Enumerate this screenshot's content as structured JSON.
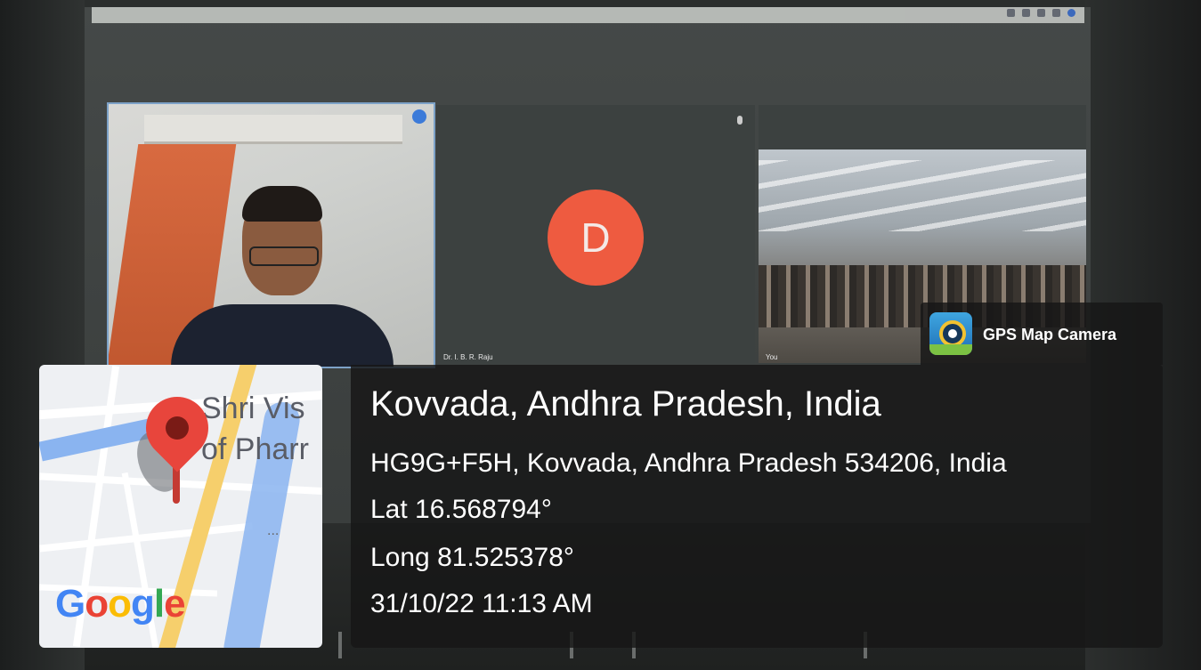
{
  "meeting": {
    "tile_1_name": "",
    "tile_2_name": "Dr. I. B. R. Raju",
    "tile_2_avatar_letter": "D",
    "tile_3_name": "You"
  },
  "map_thumbnail": {
    "label_line_1": "Shri Vis",
    "label_line_2": "of Pharr",
    "ellipsis": "...",
    "logo_letters": [
      "G",
      "o",
      "o",
      "g",
      "l",
      "e"
    ],
    "colors": {
      "pin": "#e8453c",
      "major_road": "#f6cf6c",
      "water": "#8ab4f0"
    }
  },
  "brand": {
    "name": "GPS Map Camera",
    "icon": "gps-map-camera-icon"
  },
  "location": {
    "title": "Kovvada, Andhra Pradesh, India",
    "address": "HG9G+F5H, Kovvada, Andhra Pradesh 534206, India",
    "latitude": "Lat 16.568794°",
    "longitude": "Long 81.525378°",
    "datetime": "31/10/22 11:13 AM"
  }
}
